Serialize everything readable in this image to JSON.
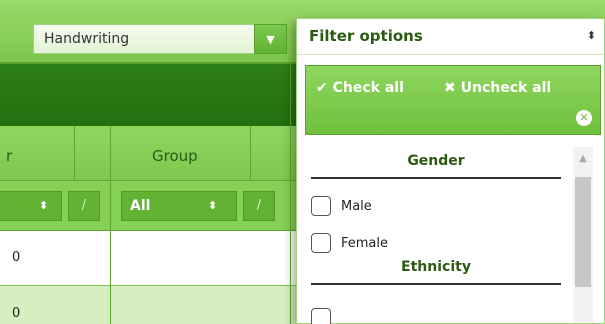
{
  "toolbar": {
    "select_value": "Handwriting",
    "select_arrow": "▼"
  },
  "grid": {
    "columns": [
      {
        "label": "r"
      },
      {
        "label": "Group"
      }
    ],
    "filter": {
      "group_select": "All",
      "slash": "/",
      "updown": "⬍"
    },
    "rows": [
      [
        "0"
      ],
      [
        "0"
      ]
    ]
  },
  "dropdown": {
    "title": "Filter options",
    "updown": "⬍",
    "check_all": "✔ Check all",
    "uncheck_all": "✖ Uncheck all",
    "close": "✕",
    "groups": [
      {
        "title": "Gender",
        "options": [
          "Male",
          "Female"
        ]
      },
      {
        "title": "Ethnicity",
        "options": []
      }
    ]
  },
  "colors": {
    "accent_green": "#7cc64b",
    "dark_green": "#226f10"
  }
}
